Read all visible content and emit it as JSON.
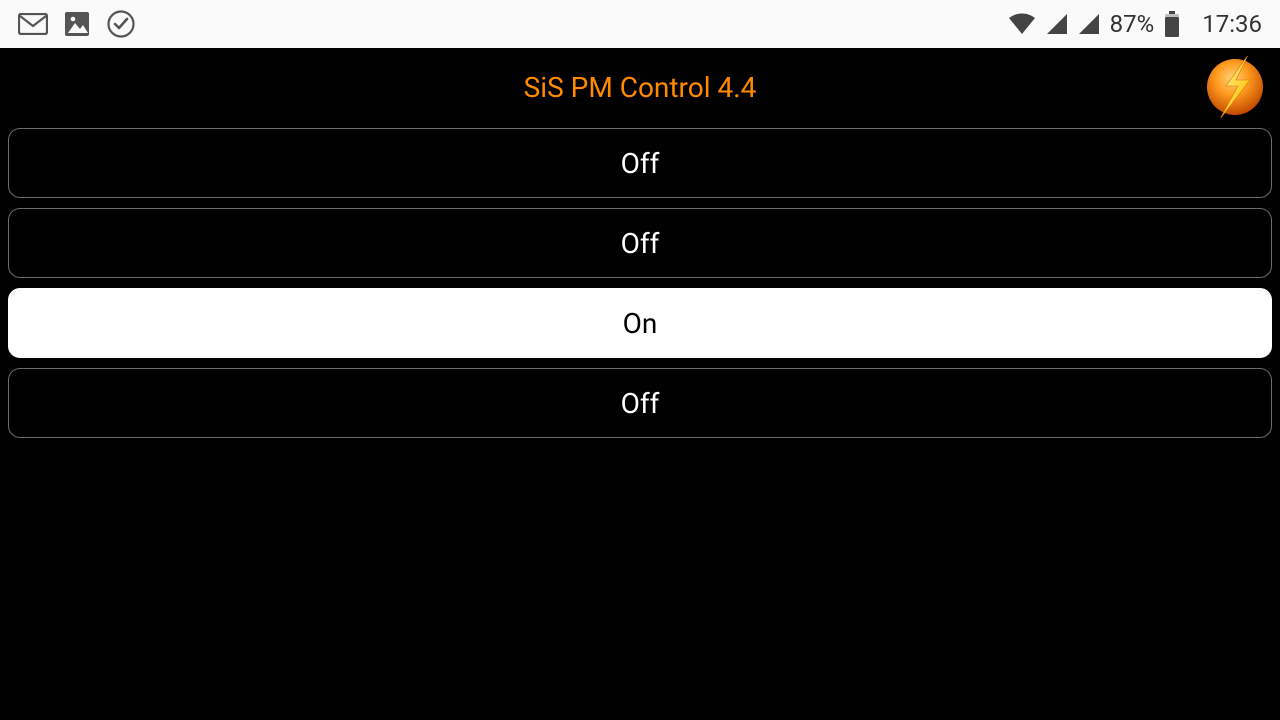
{
  "status_bar": {
    "battery_percent": "87%",
    "clock": "17:36"
  },
  "header": {
    "title": "SiS PM Control 4.4"
  },
  "outlets": [
    {
      "label": "Off",
      "state": "off"
    },
    {
      "label": "Off",
      "state": "off"
    },
    {
      "label": "On",
      "state": "on"
    },
    {
      "label": "Off",
      "state": "off"
    }
  ]
}
